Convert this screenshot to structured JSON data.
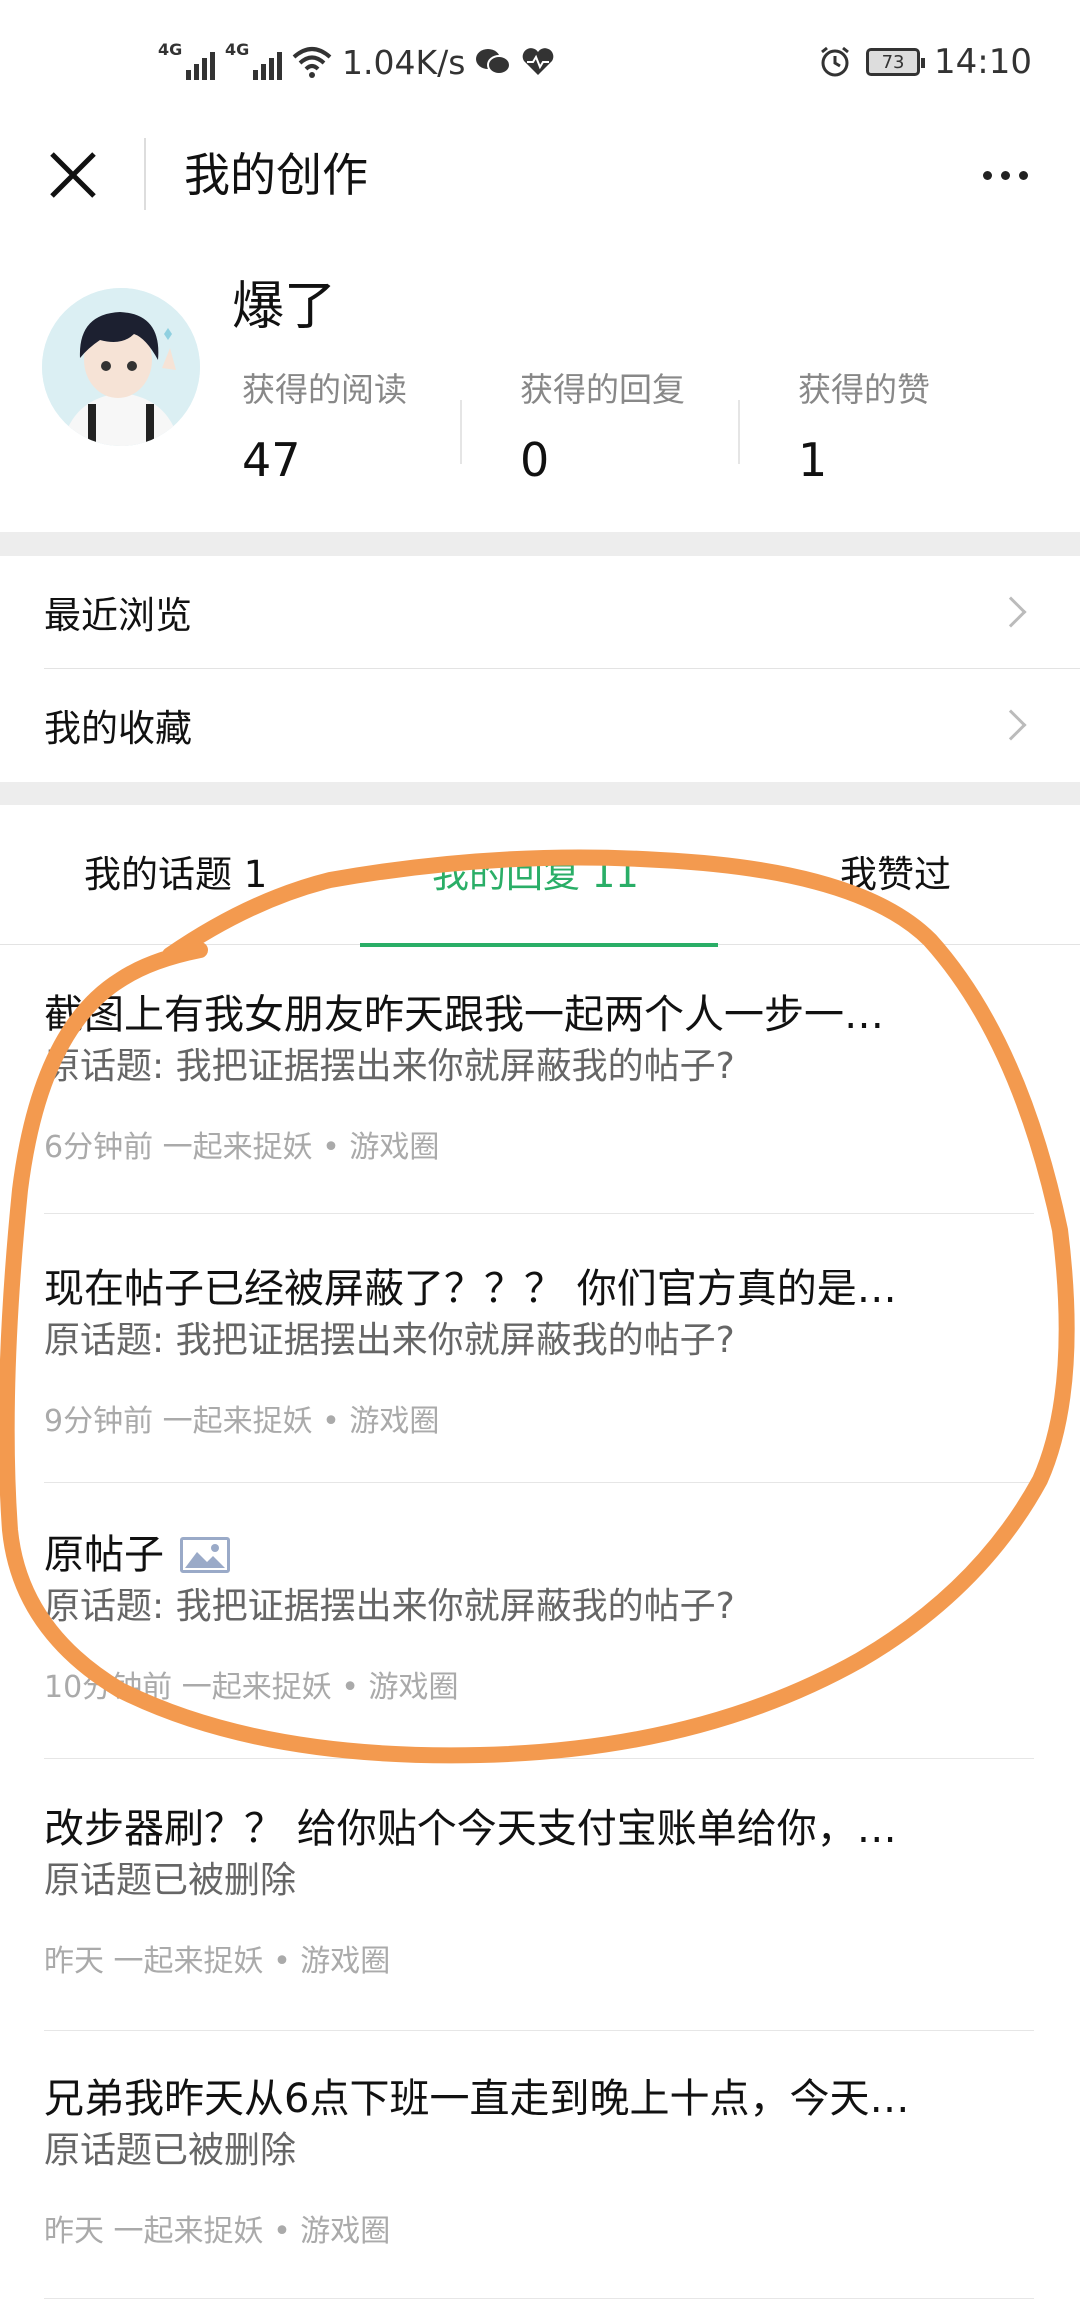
{
  "status_bar": {
    "net1": "4G",
    "net2": "4G",
    "speed": "1.04K/s",
    "battery": "73",
    "time": "14:10"
  },
  "nav": {
    "title": "我的创作"
  },
  "profile": {
    "name": "爆了",
    "stats": [
      {
        "label": "获得的阅读",
        "value": "47"
      },
      {
        "label": "获得的回复",
        "value": "0"
      },
      {
        "label": "获得的赞",
        "value": "1"
      }
    ]
  },
  "menu": [
    {
      "label": "最近浏览"
    },
    {
      "label": "我的收藏"
    }
  ],
  "tabs": [
    {
      "label": "我的话题 1"
    },
    {
      "label": "我的回复 11"
    },
    {
      "label": "我赞过"
    }
  ],
  "posts": [
    {
      "title": "截图上有我女朋友昨天跟我一起两个人一步一…",
      "sub": "原话题: 我把证据摆出来你就屏蔽我的帖子?",
      "meta": "6分钟前 一起来捉妖 • 游戏圈"
    },
    {
      "title": "现在帖子已经被屏蔽了？？？ 你们官方真的是…",
      "sub": "原话题: 我把证据摆出来你就屏蔽我的帖子?",
      "meta": "9分钟前 一起来捉妖 • 游戏圈"
    },
    {
      "title": "原帖子",
      "sub": "原话题: 我把证据摆出来你就屏蔽我的帖子?",
      "meta": "10分钟前 一起来捉妖 • 游戏圈"
    },
    {
      "title": "改步器刷？？ 给你贴个今天支付宝账单给你，…",
      "sub": "原话题已被删除",
      "meta": "昨天 一起来捉妖 • 游戏圈"
    },
    {
      "title": "兄弟我昨天从6点下班一直走到晚上十点，今天…",
      "sub": "原话题已被删除",
      "meta": "昨天 一起来捉妖 • 游戏圈"
    }
  ],
  "colors": {
    "accent": "#2aae67",
    "annotation": "#f39a4f"
  }
}
